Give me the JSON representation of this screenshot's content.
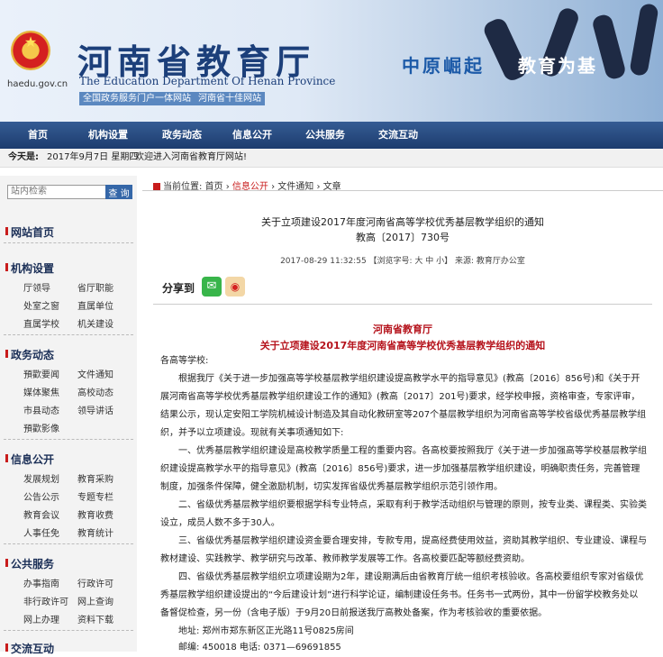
{
  "banner": {
    "title": "河南省教育厅",
    "subtitle_en": "The Education Department Of Henan Province",
    "domain": "haedu.gov.cn",
    "chip_left": "全国政务服务门户一体网站",
    "chip_right": "河南省十佳网站",
    "slogan_a": "中原崛起",
    "slogan_b": "教育为基",
    "emblem_icon": "national-emblem-icon"
  },
  "nav": {
    "items": [
      "首页",
      "机构设置",
      "政务动态",
      "信息公开",
      "公共服务",
      "交流互动"
    ]
  },
  "infobar": {
    "today_label": "今天是:",
    "date": "2017年9月7日 星期四",
    "welcome": "欢迎进入河南省教育厅网站!"
  },
  "sidebar": {
    "search_placeholder": "站内检索",
    "search_button": "查 询",
    "home": "网站首页",
    "sections": [
      {
        "title": "机构设置",
        "links": [
          "厅领导",
          "省厅职能",
          "处室之窗",
          "直属单位",
          "直属学校",
          "机关建设"
        ]
      },
      {
        "title": "政务动态",
        "links": [
          "預歡要闻",
          "文件通知",
          "媒体聚焦",
          "高校动态",
          "市县动态",
          "领导讲话",
          "預歡影像"
        ]
      },
      {
        "title": "信息公开",
        "links": [
          "发展规划",
          "教育采购",
          "公告公示",
          "专题专栏",
          "教育会议",
          "教育收费",
          "人事任免",
          "教育统计"
        ]
      },
      {
        "title": "公共服务",
        "links": [
          "办事指南",
          "行政许可",
          "非行政许可",
          "网上查询",
          "网上办理",
          "资料下载"
        ]
      },
      {
        "title": "交流互动",
        "links": []
      }
    ]
  },
  "breadcrumb": {
    "label": "当前位置:",
    "items": [
      "首页",
      "信息公开",
      "文件通知",
      "文章"
    ]
  },
  "article": {
    "title_line1": "关于立项建设2017年度河南省高等学校优秀基层教学组织的通知",
    "title_line2": "教高〔2017〕730号",
    "meta": "2017-08-29 11:32:55 【浏览字号: 大 中 小】 来源: 教育厅办公室",
    "share_label": "分享到",
    "share_icons": [
      "wechat-icon",
      "weibo-icon"
    ],
    "org": "河南省教育厅",
    "heading": "关于立项建设2017年度河南省高等学校优秀基层教学组织的通知",
    "salutation": "各高等学校:",
    "paragraphs": [
      "根据我厅《关于进一步加强高等学校基层教学组织建设提高教学水平的指导意见》(教高〔2016〕856号)和《关于开展河南省高等学校优秀基层教学组织建设工作的通知》(教高〔2017〕201号)要求，经学校申报，资格审查，专家评审，结果公示，现认定安阳工学院机械设计制造及其自动化教研室等207个基层教学组织为河南省高等学校省级优秀基层教学组织，并予以立项建设。现就有关事项通知如下:",
      "一、优秀基层教学组织建设是高校教学质量工程的重要内容。各高校要按照我厅《关于进一步加强高等学校基层教学组织建设提高教学水平的指导意见》(教高〔2016〕856号)要求，进一步加强基层教学组织建设，明确职责任务，完善管理制度，加强条件保障，健全激励机制，切实发挥省级优秀基层教学组织示范引领作用。",
      "二、省级优秀基层教学组织要根据学科专业特点，采取有利于教学活动组织与管理的原则，按专业类、课程类、实验类设立，成员人数不多于30人。",
      "三、省级优秀基层教学组织建设资金要合理安排，专款专用，提高经费使用效益，资助其教学组织、专业建设、课程与教材建设、实践教学、教学研究与改革、教师教学发展等工作。各高校要匹配等额经费资助。",
      "四、省级优秀基层教学组织立项建设期为2年，建设期满后由省教育厅统一组织考核验收。各高校要组织专家对省级优秀基层教学组织建设提出的“今后建设计划”进行科学论证，编制建设任务书。任务书一式两份，其中一份留学校教务处以备督促检查，另一份（含电子版）于9月20日前报送我厅高教处备案，作为考核验收的重要依据。"
    ],
    "address": "地址: 郑州市郑东新区正光路11号0825房间",
    "postal": "邮编: 450018    电话: 0371—69691855"
  }
}
